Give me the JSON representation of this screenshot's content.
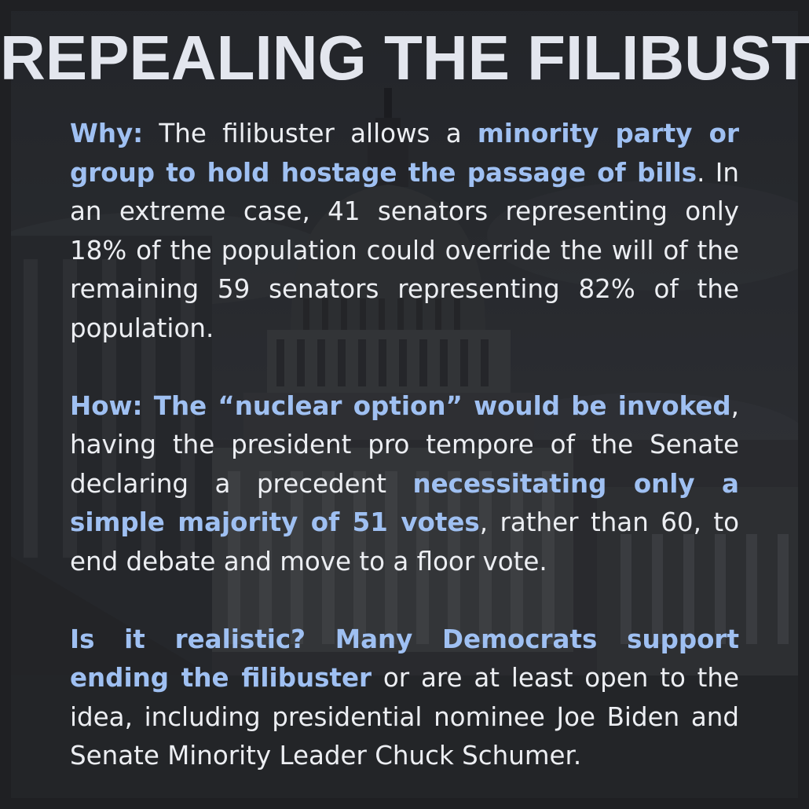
{
  "title": "REPEALING THE FILIBUSTER",
  "paragraphs": [
    {
      "segments": [
        {
          "text": "Why:",
          "highlight": true
        },
        {
          "text": " The filibuster allows a ",
          "highlight": false
        },
        {
          "text": "minority party or group to hold hostage the passage of bills",
          "highlight": true
        },
        {
          "text": ". In an extreme case, 41 senators representing only 18% of the population could override the will of the remaining 59 senators representing 82% of the population.",
          "highlight": false
        }
      ]
    },
    {
      "segments": [
        {
          "text": "How: The “nuclear option” would be invoked",
          "highlight": true
        },
        {
          "text": ", having the president pro tempore of the Senate declaring a precedent ",
          "highlight": false
        },
        {
          "text": "necessitating only a simple majority of 51 votes",
          "highlight": true
        },
        {
          "text": ", rather than 60, to end debate and move to a floor vote.",
          "highlight": false
        }
      ]
    },
    {
      "segments": [
        {
          "text": "Is it realistic? Many Democrats support ending the filibuster",
          "highlight": true
        },
        {
          "text": " or are at least open to the idea, including presidential nominee Joe Biden and Senate Minority Leader Chuck Schumer.",
          "highlight": false
        }
      ]
    }
  ],
  "colors": {
    "highlight": "#9fc0f2",
    "text": "#eceef2",
    "title": "#e3e6ee",
    "background": "#26272b"
  },
  "background_image": "capitol-building-photo"
}
